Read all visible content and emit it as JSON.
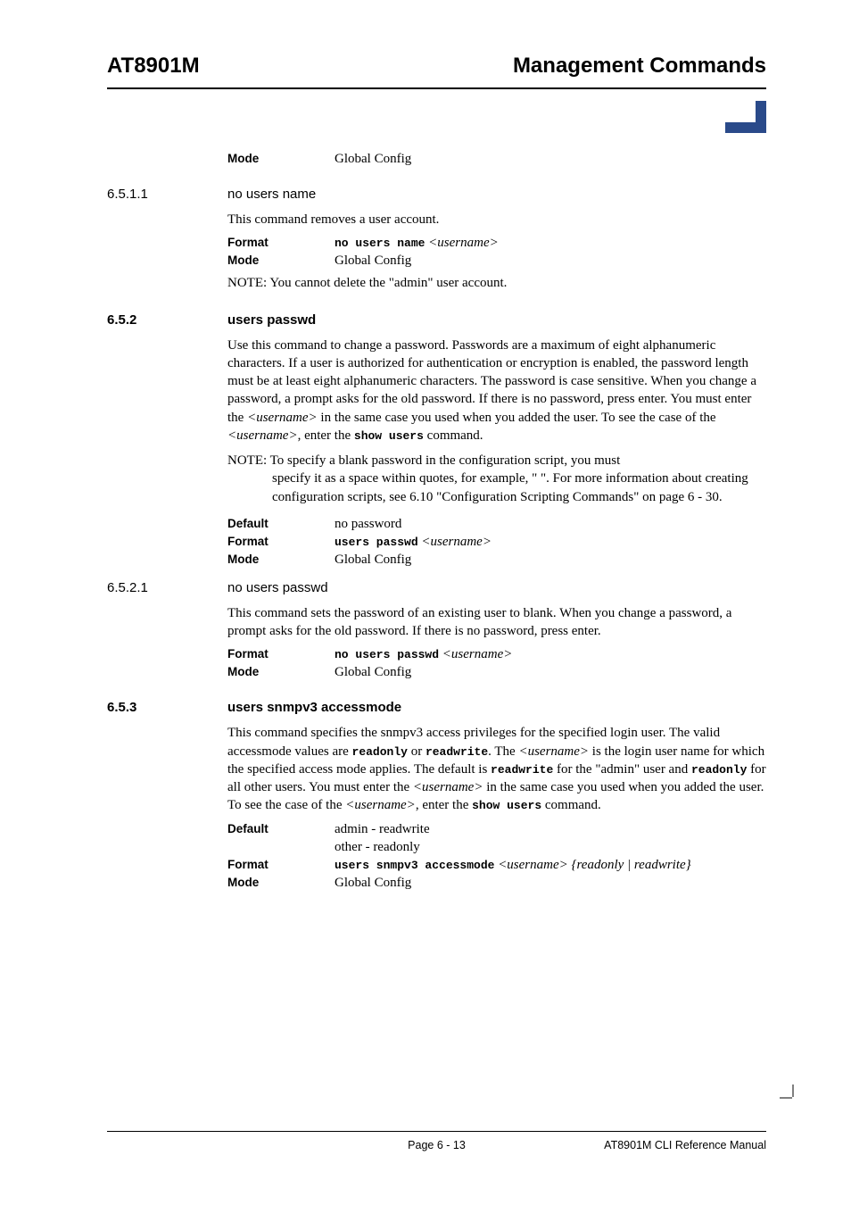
{
  "header": {
    "left": "AT8901M",
    "right": "Management Commands"
  },
  "mode_row": {
    "label": "Mode",
    "value": "Global Config"
  },
  "s6511": {
    "num": "6.5.1.1",
    "title": "no users name",
    "intro": "This command removes a user account.",
    "format_label": "Format",
    "format_value_mono": "no users name",
    "format_value_italic": " <username>",
    "mode_label": "Mode",
    "mode_value": "Global Config",
    "note": "NOTE: You cannot delete the \"admin\" user account."
  },
  "s652": {
    "num": "6.5.2",
    "title": "users passwd",
    "para1_a": "Use this command to change a password. Passwords are a maximum of eight alphanumeric characters. If a user is authorized for authentication or encryption is enabled, the password length must be at least eight alphanumeric characters. The password is case sensitive. When you change a password, a prompt asks for the old password. If there is no password, press enter. You must enter the ",
    "para1_b": "<username>",
    "para1_c": " in the same case you used when you added the user. To see the case of the ",
    "para1_d": "<username>",
    "para1_e": ", enter the ",
    "para1_f": "show users",
    "para1_g": " command.",
    "note_a": "NOTE: To specify a blank password in the configuration script, you must ",
    "note_b": "specify it as a space within quotes, for example, \" \". For more information about creating configuration scripts, see 6.10 \"Configuration Scripting Commands\"  on page 6 - 30.",
    "default_label": "Default",
    "default_value": "no password",
    "format_label": "Format",
    "format_value_mono": "users passwd",
    "format_value_italic": " <username>",
    "mode_label": "Mode",
    "mode_value": "Global Config"
  },
  "s6521": {
    "num": "6.5.2.1",
    "title": "no users passwd",
    "intro": "This command sets the password of an existing user to blank. When you change a password, a prompt asks for the old password. If there is no password, press enter.",
    "format_label": "Format",
    "format_value_mono": "no users passwd",
    "format_value_italic": " <username>",
    "mode_label": "Mode",
    "mode_value": "Global Config"
  },
  "s653": {
    "num": "6.5.3",
    "title": "users snmpv3 accessmode",
    "para_a": "This command specifies the snmpv3 access privileges for the specified login user. The valid accessmode values are ",
    "para_b": "readonly",
    "para_c": " or ",
    "para_d": "readwrite",
    "para_e": ". The ",
    "para_f": "<username>",
    "para_g": "  is the login user name for which the specified access mode applies. The default is ",
    "para_h": "readwrite",
    "para_i": " for the \"admin\" user and ",
    "para_j": "readonly",
    "para_k": " for all other users. You must enter the ",
    "para_l": "<username>",
    "para_m": " in the same case you used when you added the user. To see the case of the ",
    "para_n": "<username>",
    "para_o": ", enter the ",
    "para_p": "show users",
    "para_q": " command.",
    "default_label": "Default",
    "default_value1": "admin - readwrite",
    "default_value2": "other - readonly",
    "format_label": "Format",
    "format_value_mono": "users snmpv3 accessmode",
    "format_value_italic": " <username> {readonly | readwrite}",
    "mode_label": "Mode",
    "mode_value": "Global Config"
  },
  "footer": {
    "center": "Page 6 - 13",
    "right": "AT8901M CLI Reference Manual"
  }
}
